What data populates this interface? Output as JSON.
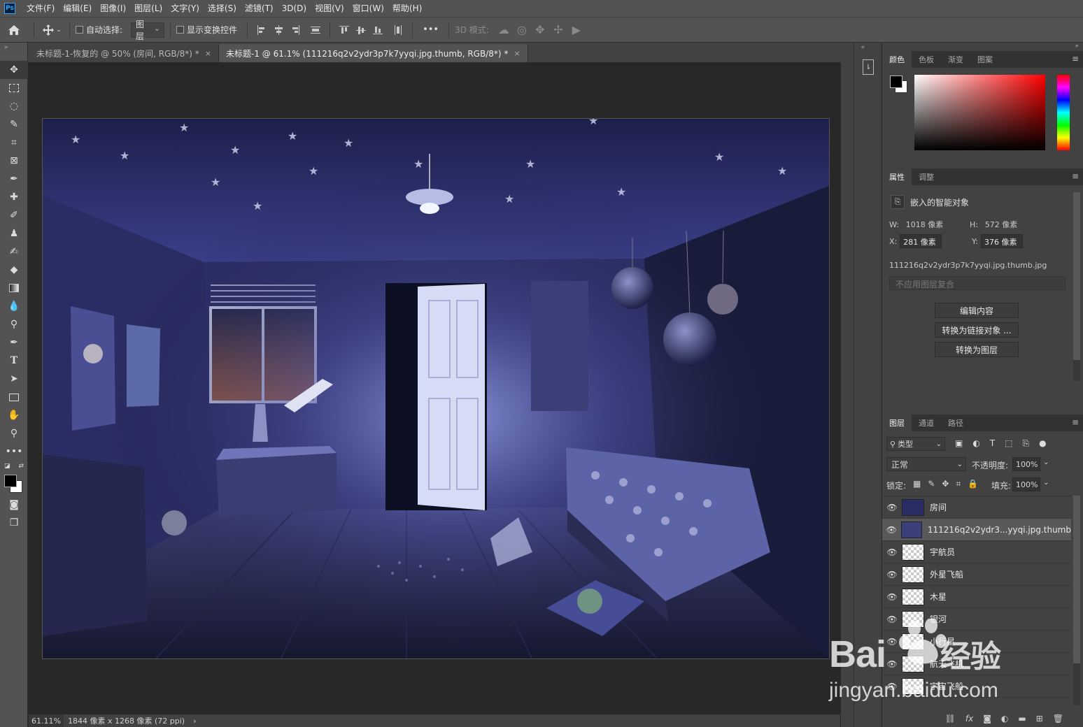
{
  "menu": {
    "logo": "Ps",
    "items": [
      "文件(F)",
      "编辑(E)",
      "图像(I)",
      "图层(L)",
      "文字(Y)",
      "选择(S)",
      "滤镜(T)",
      "3D(D)",
      "视图(V)",
      "窗口(W)",
      "帮助(H)"
    ]
  },
  "options": {
    "auto_select_label": "自动选择:",
    "auto_select_value": "图层",
    "show_transform_label": "显示变换控件",
    "more": "•••",
    "mode3d_label": "3D 模式:"
  },
  "tabs": [
    {
      "label": "未标题-1-恢复的 @ 50% (房间, RGB/8*) *",
      "close": "×"
    },
    {
      "label": "未标题-1 @ 61.1% (111216q2v2ydr3p7k7yyqi.jpg.thumb, RGB/8*) *",
      "close": "×"
    }
  ],
  "status": {
    "zoom": "61.11%",
    "doc_info": "1844 像素 x 1268 像素 (72 ppi)",
    "arrow": "›"
  },
  "color_panel": {
    "tabs": [
      "颜色",
      "色板",
      "渐变",
      "图案"
    ]
  },
  "properties_panel": {
    "tabs": [
      "属性",
      "调整"
    ],
    "type_label": "嵌入的智能对象",
    "w_label": "W:",
    "w_value": "1018 像素",
    "h_label": "H:",
    "h_value": "572 像素",
    "x_label": "X:",
    "x_value": "281 像素",
    "y_label": "Y:",
    "y_value": "376 像素",
    "filename": "111216q2v2ydr3p7k7yyqi.jpg.thumb.jpg",
    "comp_placeholder": "不应用图层复合",
    "buttons": [
      "编辑内容",
      "转换为链接对象 ...",
      "转换为图层"
    ]
  },
  "layers_panel": {
    "tabs": [
      "图层",
      "通道",
      "路径"
    ],
    "filter_label": "类型",
    "blend_mode": "正常",
    "opacity_label": "不透明度:",
    "opacity_value": "100%",
    "lock_label": "锁定:",
    "fill_label": "填充:",
    "fill_value": "100%",
    "layers": [
      {
        "name": "房间",
        "selected": false
      },
      {
        "name": "111216q2v2ydr3...yyqi.jpg.thumb",
        "selected": true
      },
      {
        "name": "宇航员",
        "selected": false
      },
      {
        "name": "外星飞船",
        "selected": false
      },
      {
        "name": "木星",
        "selected": false
      },
      {
        "name": "银河",
        "selected": false
      },
      {
        "name": "小行星",
        "selected": false
      },
      {
        "name": "航天飞机",
        "selected": false
      },
      {
        "name": "宇宙飞船",
        "selected": false
      }
    ],
    "footer_icons": [
      "link-icon",
      "fx-icon",
      "mask-icon",
      "adjustment-icon",
      "folder-icon",
      "new-layer-icon",
      "trash-icon"
    ],
    "fx_text": "fx"
  },
  "watermark": {
    "brand": "Bai",
    "brand_cn": "经验",
    "url": "jingyan.baidu.com"
  }
}
